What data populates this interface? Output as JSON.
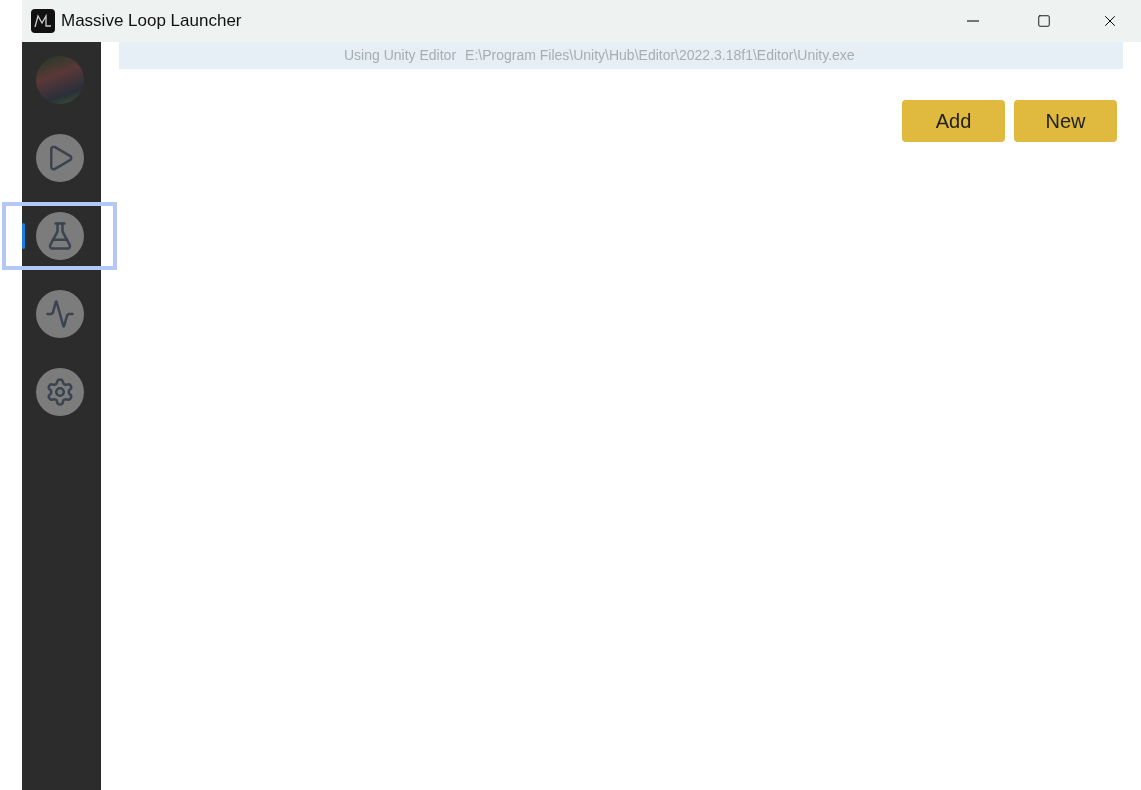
{
  "window": {
    "title": "Massive Loop Launcher"
  },
  "sidebar": {
    "items": [
      {
        "kind": "avatar",
        "selected": false,
        "focused": false
      },
      {
        "kind": "play",
        "selected": false,
        "focused": false
      },
      {
        "kind": "flask",
        "selected": true,
        "focused": true
      },
      {
        "kind": "activity",
        "selected": false,
        "focused": false
      },
      {
        "kind": "settings",
        "selected": false,
        "focused": false
      }
    ]
  },
  "editor_bar": {
    "label": "Using Unity Editor",
    "path": "E:\\Program Files\\Unity\\Hub\\Editor\\2022.3.18f1\\Editor\\Unity.exe"
  },
  "buttons": [
    "Add",
    "New"
  ]
}
